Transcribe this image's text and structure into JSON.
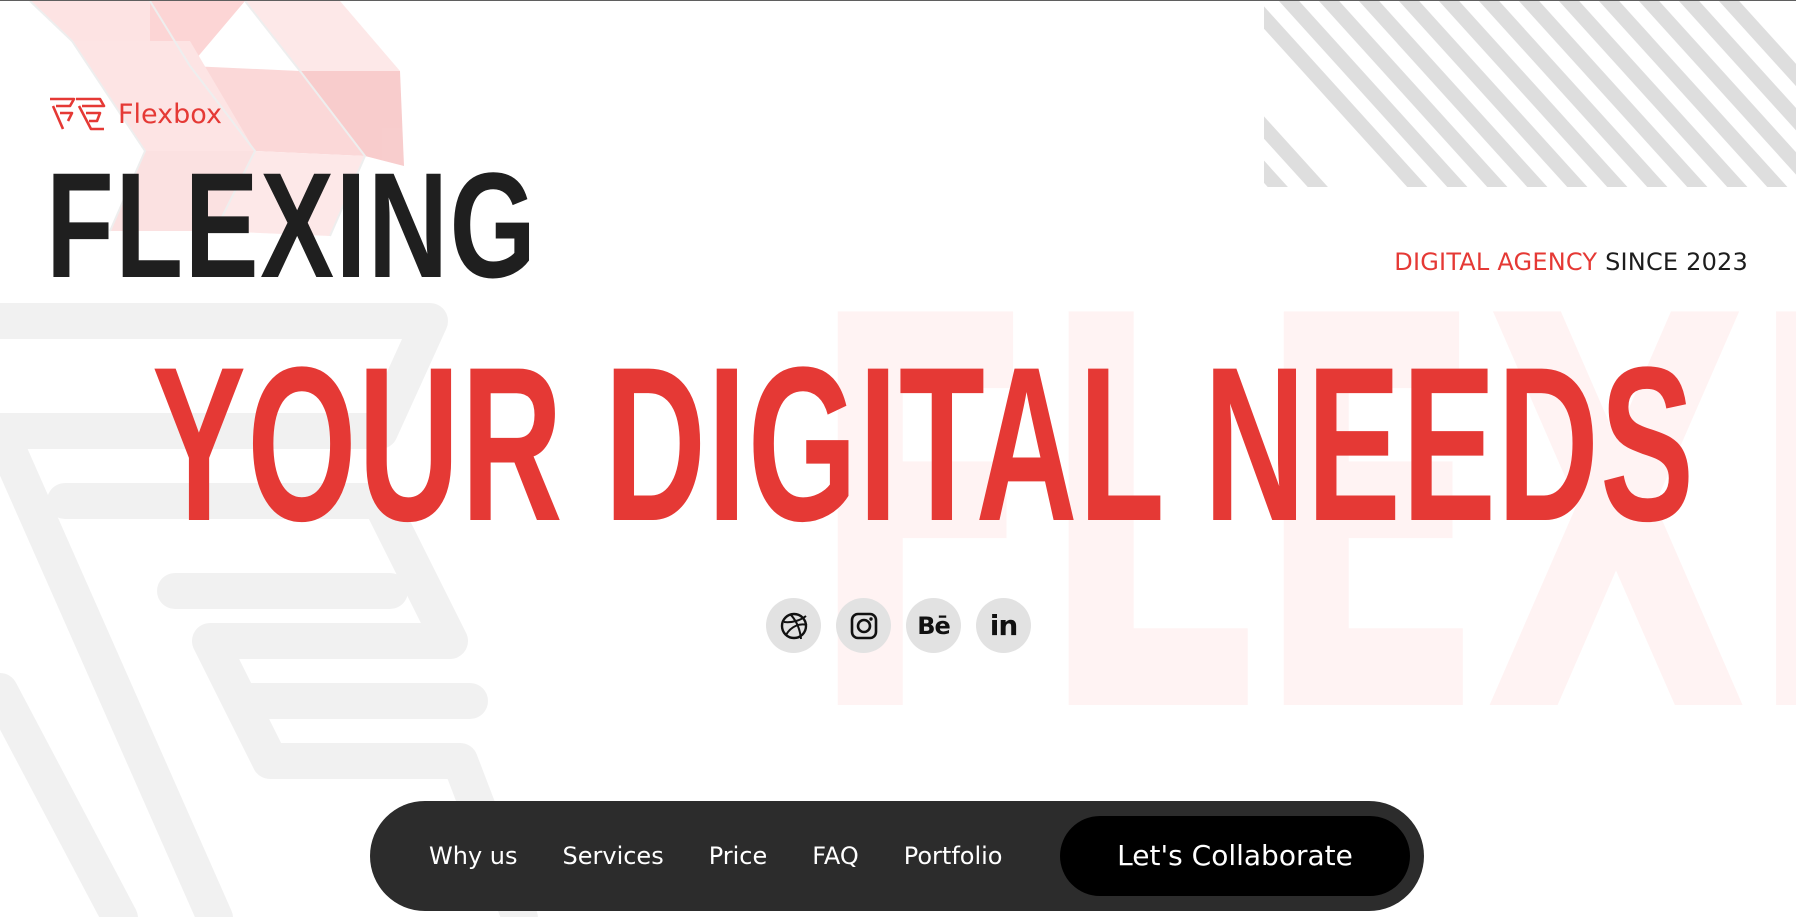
{
  "brand": {
    "name": "Flexbox",
    "logo_icon": "flexbox-logo-icon",
    "accent_color": "#e53935"
  },
  "hero": {
    "headline_dark": "FLEXING",
    "headline_red": "YOUR DIGITAL NEEDS",
    "tagline_red": "DIGITAL AGENCY",
    "tagline_dark": "SINCE 2023",
    "dark_color": "#1f1f1f"
  },
  "social": [
    {
      "name": "dribbble-icon",
      "glyph": "◍"
    },
    {
      "name": "instagram-icon",
      "glyph": "◎"
    },
    {
      "name": "behance-icon",
      "glyph": "Bē"
    },
    {
      "name": "linkedin-icon",
      "glyph": "in"
    }
  ],
  "nav": {
    "items": [
      "Why us",
      "Services",
      "Price",
      "FAQ",
      "Portfolio"
    ],
    "cta_label": "Let's Collaborate",
    "bar_color": "#2c2c2c",
    "cta_color": "#000000"
  }
}
